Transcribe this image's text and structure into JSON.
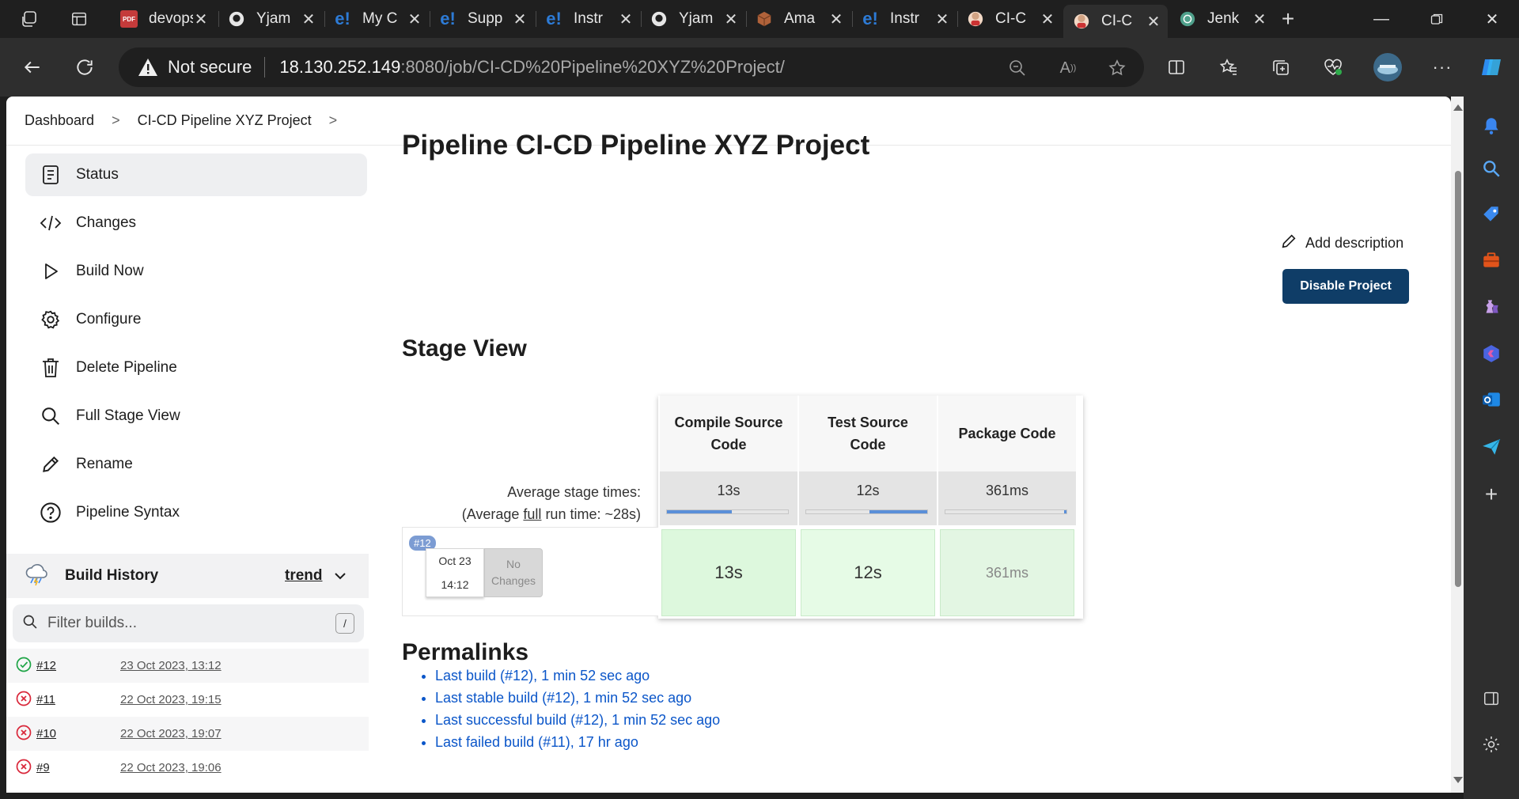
{
  "browser": {
    "tabs": [
      {
        "title": "devops",
        "fav": "pdf"
      },
      {
        "title": "Yjam",
        "fav": "github"
      },
      {
        "title": "My C",
        "fav": "edureka"
      },
      {
        "title": "Supp",
        "fav": "edureka"
      },
      {
        "title": "Instr",
        "fav": "edureka"
      },
      {
        "title": "Yjam",
        "fav": "github"
      },
      {
        "title": "Ama",
        "fav": "aws"
      },
      {
        "title": "Instr",
        "fav": "edureka"
      },
      {
        "title": "CI-C",
        "fav": "jenkins"
      },
      {
        "title": "CI-C",
        "fav": "jenkins"
      },
      {
        "title": "Jenk",
        "fav": "chatgpt"
      }
    ],
    "address": {
      "security": "Not secure",
      "host": "18.130.252.149",
      "path": ":8080/job/CI-CD%20Pipeline%20XYZ%20Project/"
    }
  },
  "breadcrumb": {
    "root": "Dashboard",
    "project": "CI-CD Pipeline XYZ Project"
  },
  "sidebar": {
    "tasks": [
      {
        "label": "Status",
        "icon": "status-icon"
      },
      {
        "label": "Changes",
        "icon": "code-icon"
      },
      {
        "label": "Build Now",
        "icon": "play-icon"
      },
      {
        "label": "Configure",
        "icon": "gear-icon"
      },
      {
        "label": "Delete Pipeline",
        "icon": "trash-icon"
      },
      {
        "label": "Full Stage View",
        "icon": "search-icon"
      },
      {
        "label": "Rename",
        "icon": "pencil-icon"
      },
      {
        "label": "Pipeline Syntax",
        "icon": "help-icon"
      }
    ],
    "build_history": {
      "title": "Build History",
      "trend": "trend",
      "filter_placeholder": "Filter builds...",
      "filter_shortcut": "/",
      "builds": [
        {
          "number": "#12",
          "date": "23 Oct 2023, 13:12",
          "status": "success"
        },
        {
          "number": "#11",
          "date": "22 Oct 2023, 19:15",
          "status": "failed"
        },
        {
          "number": "#10",
          "date": "22 Oct 2023, 19:07",
          "status": "failed"
        },
        {
          "number": "#9",
          "date": "22 Oct 2023, 19:06",
          "status": "failed"
        }
      ]
    }
  },
  "main": {
    "title": "Pipeline CI-CD Pipeline XYZ Project",
    "add_description": "Add description",
    "disable_button": "Disable Project",
    "stage_view_title": "Stage View",
    "average_label": "Average stage times:",
    "average_full_prefix": "(Average ",
    "average_full_link": "full",
    "average_full_suffix": " run time: ~28s)",
    "stages": [
      {
        "name_line1": "Compile Source",
        "name_line2": "Code",
        "avg": "13s",
        "avg_fill": 0.53,
        "run": "13s"
      },
      {
        "name_line1": "Test Source",
        "name_line2": "Code",
        "avg": "12s",
        "avg_fill": 0.47,
        "run": "12s"
      },
      {
        "name_line1": "Package Code",
        "name_line2": "",
        "avg": "361ms",
        "avg_fill": 0.01,
        "run": "361ms"
      }
    ],
    "run": {
      "badge": "#12",
      "date": "Oct 23",
      "time": "14:12",
      "changes_line1": "No",
      "changes_line2": "Changes"
    },
    "permalinks_title": "Permalinks",
    "permalinks": [
      "Last build (#12), 1 min 52 sec ago",
      "Last stable build (#12), 1 min 52 sec ago",
      "Last successful build (#12), 1 min 52 sec ago",
      "Last failed build (#11), 17 hr ago"
    ]
  },
  "colors": {
    "disable_button": "#0f3d67",
    "link": "#0b56c9",
    "success": "#1ea446",
    "failed": "#d9273a",
    "stage_success": "#ddf8dd",
    "avg_bar": "#5a8fd8"
  }
}
